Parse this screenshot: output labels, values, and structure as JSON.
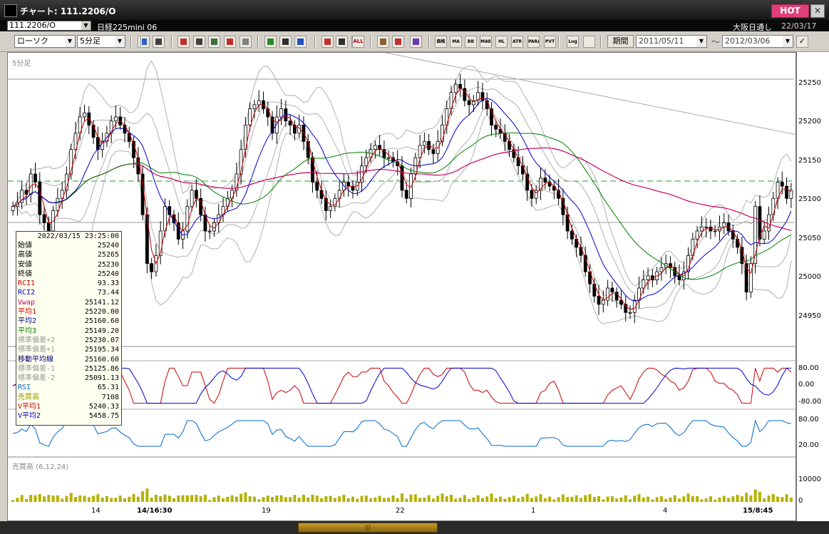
{
  "window": {
    "title": "チャート: 111.2206/O",
    "hot_label": "HOT",
    "close_label": "✕"
  },
  "symbol": {
    "code": "111.2206/O",
    "instrument": "日経225mini 06",
    "market": "大阪日通し",
    "date": "22/03/17"
  },
  "toolbar": {
    "chart_type": "ローソク",
    "interval": "5分足",
    "tools_a": [
      "zoom",
      "draw-line",
      "gain",
      "quote",
      "bar",
      "candle-compare",
      "alert"
    ],
    "tools_b": [
      "pencil",
      "cursor",
      "undo",
      "fit-prev",
      "fit-all",
      "all-view",
      "settings",
      "wrench",
      "palette"
    ],
    "indicator_buttons": [
      "価格帯",
      "MA",
      "BB",
      "MAE",
      "HL",
      "ATR",
      "PARA",
      "PVT",
      "Log"
    ],
    "all_label": "ALL",
    "period_label": "期間",
    "date_from": "2011/05/11",
    "date_to": "2012/03/06",
    "tilde": "～"
  },
  "price_panel": {
    "label": "5分足",
    "y_ticks": [
      "25250",
      "25200",
      "25150",
      "25100",
      "25050",
      "25000",
      "24950"
    ]
  },
  "osc_panel": {
    "y_ticks": [
      "80.00",
      "0.00",
      "-80.00"
    ]
  },
  "rsi_panel": {
    "y_ticks": [
      "80.00",
      "20.00"
    ]
  },
  "volume_panel": {
    "label": "売買高 (6,12,24)",
    "y_ticks": [
      "10000",
      "0"
    ]
  },
  "x_labels": [
    "14",
    "14/16:30",
    "19",
    "22",
    "1",
    "4",
    "15/8:45"
  ],
  "info": {
    "timestamp": "2022/03/15  23:25:00",
    "rows": [
      {
        "label": "始値",
        "value": "25240",
        "color": "#000000"
      },
      {
        "label": "高値",
        "value": "25265",
        "color": "#000000"
      },
      {
        "label": "安値",
        "value": "25230",
        "color": "#000000"
      },
      {
        "label": "終値",
        "value": "25240",
        "color": "#000000"
      },
      {
        "label": "RCI1",
        "value": "93.33",
        "color": "#cc0000"
      },
      {
        "label": "RCI2",
        "value": "73.44",
        "color": "#0000cc"
      },
      {
        "label": "Vwap",
        "value": "25141.12",
        "color": "#cc0066"
      },
      {
        "label": "平均1",
        "value": "25220.00",
        "color": "#cc0000"
      },
      {
        "label": "平均2",
        "value": "25160.60",
        "color": "#000080"
      },
      {
        "label": "平均3",
        "value": "25149.20",
        "color": "#008000"
      },
      {
        "label": "標準偏差+2",
        "value": "25230.07",
        "color": "#999999"
      },
      {
        "label": "標準偏差+1",
        "value": "25195.34",
        "color": "#999999"
      },
      {
        "label": "移動平均線",
        "value": "25160.60",
        "color": "#000080"
      },
      {
        "label": "標準偏差-1",
        "value": "25125.86",
        "color": "#999999"
      },
      {
        "label": "標準偏差-2",
        "value": "25091.13",
        "color": "#999999"
      },
      {
        "label": "RSI",
        "value": "65.31",
        "color": "#0066cc"
      },
      {
        "label": "売買高",
        "value": "7108",
        "color": "#999900"
      },
      {
        "label": "V平均1",
        "value": "5240.33",
        "color": "#cc0000"
      },
      {
        "label": "V平均2",
        "value": "5458.75",
        "color": "#0000cc"
      }
    ]
  },
  "chart_data": {
    "type": "line",
    "series": [
      {
        "name": "終値",
        "values": [
          25090,
          25095,
          25110,
          25105,
          25130,
          25120,
          25080,
          25070,
          25060,
          25085,
          25100,
          25110,
          25130,
          25160,
          25180,
          25200,
          25205,
          25190,
          25175,
          25160,
          25170,
          25180,
          25195,
          25200,
          25190,
          25180,
          25170,
          25150,
          25130,
          25080,
          25020,
          25010,
          25030,
          25060,
          25090,
          25080,
          25070,
          25050,
          25060,
          25090,
          25110,
          25100,
          25080,
          25060,
          25060,
          25070,
          25080,
          25090,
          25100,
          25110,
          25130,
          25160,
          25190,
          25210,
          25215,
          25220,
          25210,
          25200,
          25180,
          25200,
          25210,
          25195,
          25190,
          25180,
          25190,
          25170,
          25150,
          25120,
          25110,
          25100,
          25085,
          25090,
          25100,
          25110,
          25120,
          25115,
          25110,
          25120,
          25140,
          25150,
          25160,
          25165,
          25160,
          25150,
          25150,
          25145,
          25140,
          25110,
          25100,
          25130,
          25150,
          25165,
          25170,
          25160,
          25155,
          25170,
          25190,
          25210,
          25230,
          25240,
          25235,
          25220,
          25215,
          25220,
          25230,
          25220,
          25210,
          25190,
          25185,
          25180,
          25170,
          25160,
          25150,
          25140,
          25130,
          25110,
          25100,
          25110,
          25125,
          25120,
          25115,
          25110,
          25100,
          25080,
          25060,
          25050,
          25040,
          25030,
          25010,
          24995,
          24980,
          24970,
          24975,
          24990,
          24985,
          24975,
          24970,
          24960,
          24960,
          24975,
          24990,
          25000,
          25005,
          25000,
          25010,
          25015,
          25020,
          25015,
          25005,
          25000,
          25010,
          25030,
          25050,
          25060,
          25065,
          25065,
          25060,
          25060,
          25065,
          25070,
          25060,
          25050,
          25040,
          25020,
          24985,
          25020,
          25090,
          25050,
          25060,
          25080,
          25100,
          25120,
          25115,
          25100,
          25110
        ]
      },
      {
        "name": "平均1",
        "values": []
      },
      {
        "name": "平均2",
        "values": []
      },
      {
        "name": "平均3",
        "values": []
      }
    ],
    "ylim": [
      24920,
      25270
    ],
    "x_labels": [
      "14",
      "14/16:30",
      "19",
      "22",
      "1",
      "4",
      "15/8:45"
    ]
  }
}
